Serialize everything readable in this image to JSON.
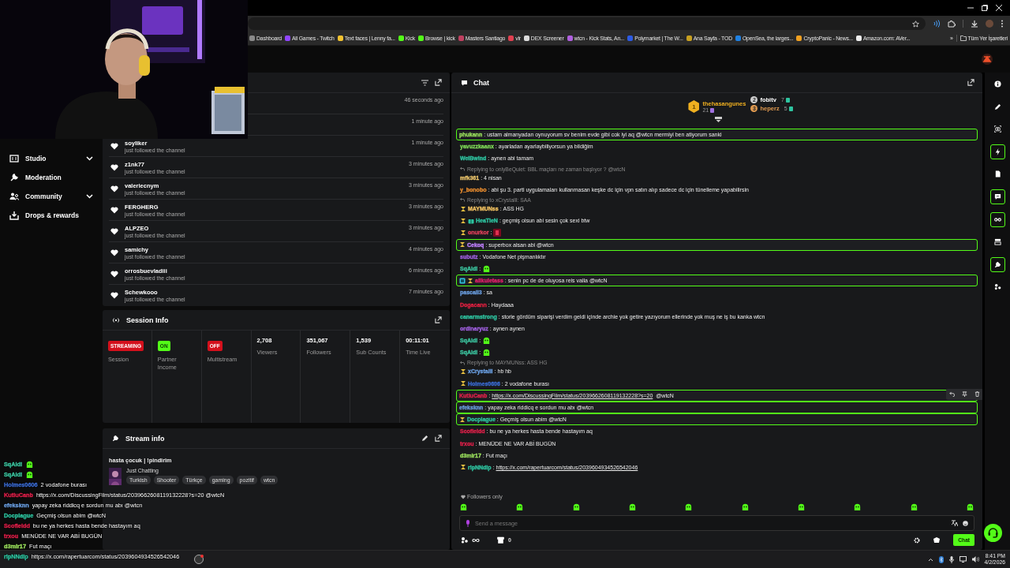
{
  "bookmarks": [
    {
      "label": "Dashboard",
      "color": "#8a8a8a"
    },
    {
      "label": "All Games - Twitch",
      "color": "#9146ff"
    },
    {
      "label": "Text faces | Lenny fa...",
      "color": "#f2c230"
    },
    {
      "label": "Kick",
      "color": "#53fc18"
    },
    {
      "label": "Browse | kick",
      "color": "#53fc18"
    },
    {
      "label": "Masters Santiago",
      "color": "#c04060"
    },
    {
      "label": "vlr",
      "color": "#e04050"
    },
    {
      "label": "DEX Screener",
      "color": "#dddddd"
    },
    {
      "label": "wtcn - Kick Stats, An...",
      "color": "#b060e0"
    },
    {
      "label": "Polymarket | The W...",
      "color": "#2d5be3"
    },
    {
      "label": "Ana Sayfa - TOD",
      "color": "#c8a020"
    },
    {
      "label": "OpenSea, the larges...",
      "color": "#2081e2"
    },
    {
      "label": "CryptoPanic - News...",
      "color": "#f0a020"
    },
    {
      "label": "Amazon.com: AVer...",
      "color": "#eeeeee"
    }
  ],
  "bookmarks_more": "»",
  "all_bookmarks": "Tüm Yer İşaretleri",
  "sidebar": {
    "items": [
      {
        "label": "Studio",
        "has_submenu": true,
        "kind": "studio"
      },
      {
        "label": "Moderation",
        "has_submenu": false,
        "kind": "moderation"
      },
      {
        "label": "Community",
        "has_submenu": true,
        "kind": "community"
      },
      {
        "label": "Drops & rewards",
        "has_submenu": false,
        "kind": "drops"
      }
    ]
  },
  "followers": {
    "rows": [
      {
        "time": "46 seconds ago"
      },
      {
        "time": "1 minute ago"
      },
      {
        "name": "soyliker",
        "note": "just followed the channel",
        "time": "1 minute ago"
      },
      {
        "name": "z1nk77",
        "note": "just followed the channel",
        "time": "3 minutes ago"
      },
      {
        "name": "valeriecnym",
        "note": "just followed the channel",
        "time": "3 minutes ago"
      },
      {
        "name": "FERGHERG",
        "note": "just followed the channel",
        "time": "3 minutes ago"
      },
      {
        "name": "ALPZEO",
        "note": "just followed the channel",
        "time": "3 minutes ago"
      },
      {
        "name": "samichy",
        "note": "just followed the channel",
        "time": "4 minutes ago"
      },
      {
        "name": "orrosbuevladiii",
        "note": "just followed the channel",
        "time": "6 minutes ago"
      },
      {
        "name": "Schewkooo",
        "note": "just followed the channel",
        "time": "7 minutes ago"
      }
    ]
  },
  "session_info": {
    "title": "Session Info",
    "stats": [
      {
        "kind": "badge",
        "value": "STREAMING",
        "label": "Session",
        "color": "#d4101c"
      },
      {
        "kind": "badge",
        "value": "ON",
        "label": "Partner Income",
        "color": "#53fc18"
      },
      {
        "kind": "badge",
        "value": "OFF",
        "label": "Multistream",
        "color": "#d4101c"
      },
      {
        "kind": "number",
        "value": "2,708",
        "label": "Viewers"
      },
      {
        "kind": "number",
        "value": "351,067",
        "label": "Followers"
      },
      {
        "kind": "number",
        "value": "1,539",
        "label": "Sub Counts"
      },
      {
        "kind": "number",
        "value": "00:11:01",
        "label": "Time Live"
      }
    ]
  },
  "stream_info": {
    "title": "Stream info",
    "stream_title": "hasta çocuk | !pindirim",
    "category": "Just Chatting",
    "tags": [
      "Turkish",
      "Shooter",
      "Türkçe",
      "gaming",
      "pozitif",
      "wtcn"
    ]
  },
  "chat": {
    "title": "Chat",
    "leaders": [
      {
        "rank": "1",
        "name": "thehasangunes",
        "count": "21"
      },
      {
        "rank": "2",
        "name": "fobitv",
        "count": "7"
      },
      {
        "rank": "3",
        "name": "heperz",
        "count": "5"
      }
    ],
    "messages": [
      {
        "name": "phukann",
        "sep": ":",
        "color": "#9be15d",
        "text": "ustam almanyadan oynuyorum sv benim evde gibi cok iyi aq @wtcn mermiyi ben atiyorum sanki",
        "highlighted": true,
        "hovered": false
      },
      {
        "name": "yavuzzkaanx",
        "sep": ":",
        "color": "#7ed957",
        "text": "ayarladan ayarlaybiliyorsun ya bildiğim",
        "highlighted": false,
        "hovered": false
      },
      {
        "name": "WeiBwind",
        "sep": ":",
        "color": "#2ec4a0",
        "text": "aynen abi tamam",
        "highlighted": false,
        "hovered": false
      },
      {
        "name": "mfk361",
        "sep": ":",
        "color": "#e8c26a",
        "reply_to": "Replying to onlyBeQuiet: BBL maçları ne zaman başlıyor ? @wtcN",
        "text": "4 nisan",
        "highlighted": false,
        "hovered": false
      },
      {
        "name": "y_bonobo",
        "sep": ":",
        "color": "#e58a2e",
        "text": "abi şu 3. parti uygulamaları kullanmasan keşke dc için vpn satın alıp sadece dc için tünelleme yapabilirsin",
        "highlighted": false,
        "hovered": false
      },
      {
        "name": "MAYMUNss",
        "sep": ":",
        "color": "#f0c060",
        "reply_to": "Replying to xCrystalll: SAA",
        "badges": [
          {
            "kind": "hourglass"
          }
        ],
        "text": "ASS HG",
        "highlighted": false,
        "hovered": false
      },
      {
        "name": "HeaTieN",
        "sep": ":",
        "color": "#2ec4a0",
        "badges": [
          {
            "kind": "hourglass"
          },
          {
            "kind": "gift"
          }
        ],
        "text": "geçmiş olsun abi sesin çok sexi btw",
        "highlighted": false,
        "hovered": false
      },
      {
        "name": "onurkor",
        "sep": ":",
        "color": "#e0405a",
        "badges": [
          {
            "kind": "hourglass"
          }
        ],
        "kind": "emote",
        "highlighted": false,
        "hovered": false
      },
      {
        "name": "Cekoq",
        "sep": ":",
        "color": "#c080ff",
        "badges": [
          {
            "kind": "hourglass"
          }
        ],
        "text": "superbox alsan abi @wtcn",
        "highlighted": true,
        "hovered": false
      },
      {
        "name": "subutz",
        "sep": ":",
        "color": "#a060e0",
        "text": "Vodafone Net pişmanlıktır",
        "highlighted": false,
        "hovered": false
      },
      {
        "name": "SqAldi",
        "sep": ":",
        "color": "#3cc6a0",
        "kind": "emote",
        "highlighted": false,
        "hovered": false
      },
      {
        "name": "alikuletass",
        "sep": ":",
        "color": "#e0206a",
        "badges": [
          {
            "kind": "og"
          },
          {
            "kind": "hourglass"
          }
        ],
        "text": "senin pc de de oluyosa reis valla @wtcN",
        "highlighted": true,
        "hovered": false
      },
      {
        "name": "pascall3",
        "sep": ":",
        "color": "#6a9ee0",
        "text": "sa",
        "highlighted": false,
        "hovered": false
      },
      {
        "name": "Dogacann",
        "sep": ":",
        "color": "#e02040",
        "text": "Haydaaa",
        "highlighted": false,
        "hovered": false
      },
      {
        "name": "canarmstrong",
        "sep": ":",
        "color": "#2ec4a0",
        "text": "storie gördüm siparişi verdim geldi içinde archie yok getire yazıyorum ellerinde yok muş ne iş bu kanka wtcn",
        "highlighted": false,
        "hovered": false
      },
      {
        "name": "ordinaryuz",
        "sep": ":",
        "color": "#a060e0",
        "text": "aynen aynen",
        "highlighted": false,
        "hovered": false
      },
      {
        "name": "SqAldi",
        "sep": ":",
        "color": "#3cc6a0",
        "kind": "emote",
        "highlighted": false,
        "hovered": false
      },
      {
        "name": "SqAldi",
        "sep": ":",
        "color": "#3cc6a0",
        "kind": "emote",
        "highlighted": false,
        "hovered": false
      },
      {
        "name": "xCrystalll",
        "sep": ":",
        "color": "#6a9ee0",
        "reply_to": "Replying to MAYMUNss: ASS HG",
        "badges": [
          {
            "kind": "hourglass"
          }
        ],
        "text": "hb hb",
        "highlighted": false,
        "hovered": false
      },
      {
        "name": "Holmes0606",
        "sep": ":",
        "color": "#3a6ad0",
        "badges": [
          {
            "kind": "hourglass"
          }
        ],
        "text": "2 vodafone burası",
        "highlighted": false,
        "hovered": false
      },
      {
        "name": "KutluCanb",
        "sep": ":",
        "color": "#e0204a",
        "link": "https://x.com/DiscussingFilm/status/2039662608119132228?s=20",
        "text": " @wtcN",
        "highlighted": true,
        "hovered": true
      },
      {
        "name": "efeksknn",
        "sep": ":",
        "color": "#6a9ee0",
        "text": "yapay zeka riddicq e sordun mu abı @wtcn",
        "highlighted": true,
        "hovered": false
      },
      {
        "name": "Docplague",
        "sep": ":",
        "color": "#2ec4a0",
        "badges": [
          {
            "kind": "hourglass"
          }
        ],
        "text": "Geçmiş olsun abim @wtcN",
        "highlighted": true,
        "hovered": false
      },
      {
        "name": "Scofieldd",
        "sep": ":",
        "color": "#e0204a",
        "text": "bu ne ya herkes hasta bende hastayım aq",
        "highlighted": false,
        "hovered": false
      },
      {
        "name": "trxou",
        "sep": ":",
        "color": "#e0204a",
        "text": "MENÜDE NE VAR ABİ BUGÜN",
        "highlighted": false,
        "hovered": false
      },
      {
        "name": "d3mir17",
        "sep": ":",
        "color": "#9be15d",
        "text": "Fut maçı",
        "highlighted": false,
        "hovered": false
      },
      {
        "name": "ripNNdip",
        "sep": ":",
        "color": "#2ec4a0",
        "badges": [
          {
            "kind": "hourglass"
          }
        ],
        "link": "https://x.com/rapertuarcom/status/2039604934526542046",
        "highlighted": false,
        "hovered": false
      }
    ],
    "mode_note": "Followers only",
    "input": {
      "placeholder": "Send a message"
    },
    "store_count": "0",
    "send_button": "Chat"
  },
  "rail": [
    {
      "kind": "info",
      "active": false
    },
    {
      "kind": "pencil",
      "active": false
    },
    {
      "kind": "camera",
      "active": false
    },
    {
      "kind": "bolt",
      "active": true
    },
    {
      "kind": "note",
      "active": false
    },
    {
      "kind": "chat",
      "active": true
    },
    {
      "kind": "link",
      "active": true
    },
    {
      "kind": "stack",
      "active": false
    },
    {
      "kind": "wrench",
      "active": true
    },
    {
      "kind": "nodes",
      "active": false
    }
  ],
  "overlay_chat": [
    {
      "name": "SqAldi",
      "color": "#3cc6a0",
      "kind": "emote"
    },
    {
      "name": "SqAldi",
      "color": "#3cc6a0",
      "kind": "emote"
    },
    {
      "name": "Holmes0606",
      "color": "#3a6ad0",
      "text": "2 vodafone burası"
    },
    {
      "name": "KutluCanb",
      "color": "#e0204a",
      "text": "https://x.com/DiscussingFilm/status/2039662608119132228?s=20 @wtcN"
    },
    {
      "name": "efeksknn",
      "color": "#6a9ee0",
      "text": "yapay zeka riddicq e sordun mu abı @wtcn"
    },
    {
      "name": "Docplague",
      "color": "#2ec4a0",
      "text": "Geçmiş olsun abim @wtcN"
    },
    {
      "name": "Scofieldd",
      "color": "#e0204a",
      "text": "bu ne ya herkes hasta bende hastayım aq"
    },
    {
      "name": "trxou",
      "color": "#e0204a",
      "text": "MENÜDE NE VAR ABİ BUGÜN"
    },
    {
      "name": "d3mir17",
      "color": "#9be15d",
      "text": "Fut maçı"
    },
    {
      "name": "ripNNdip",
      "color": "#2ec4a0",
      "text": "https://x.com/rapertuarcom/status/2039604934526542046"
    }
  ],
  "clock": {
    "time": "8:41 PM",
    "date": "4/2/2026"
  }
}
